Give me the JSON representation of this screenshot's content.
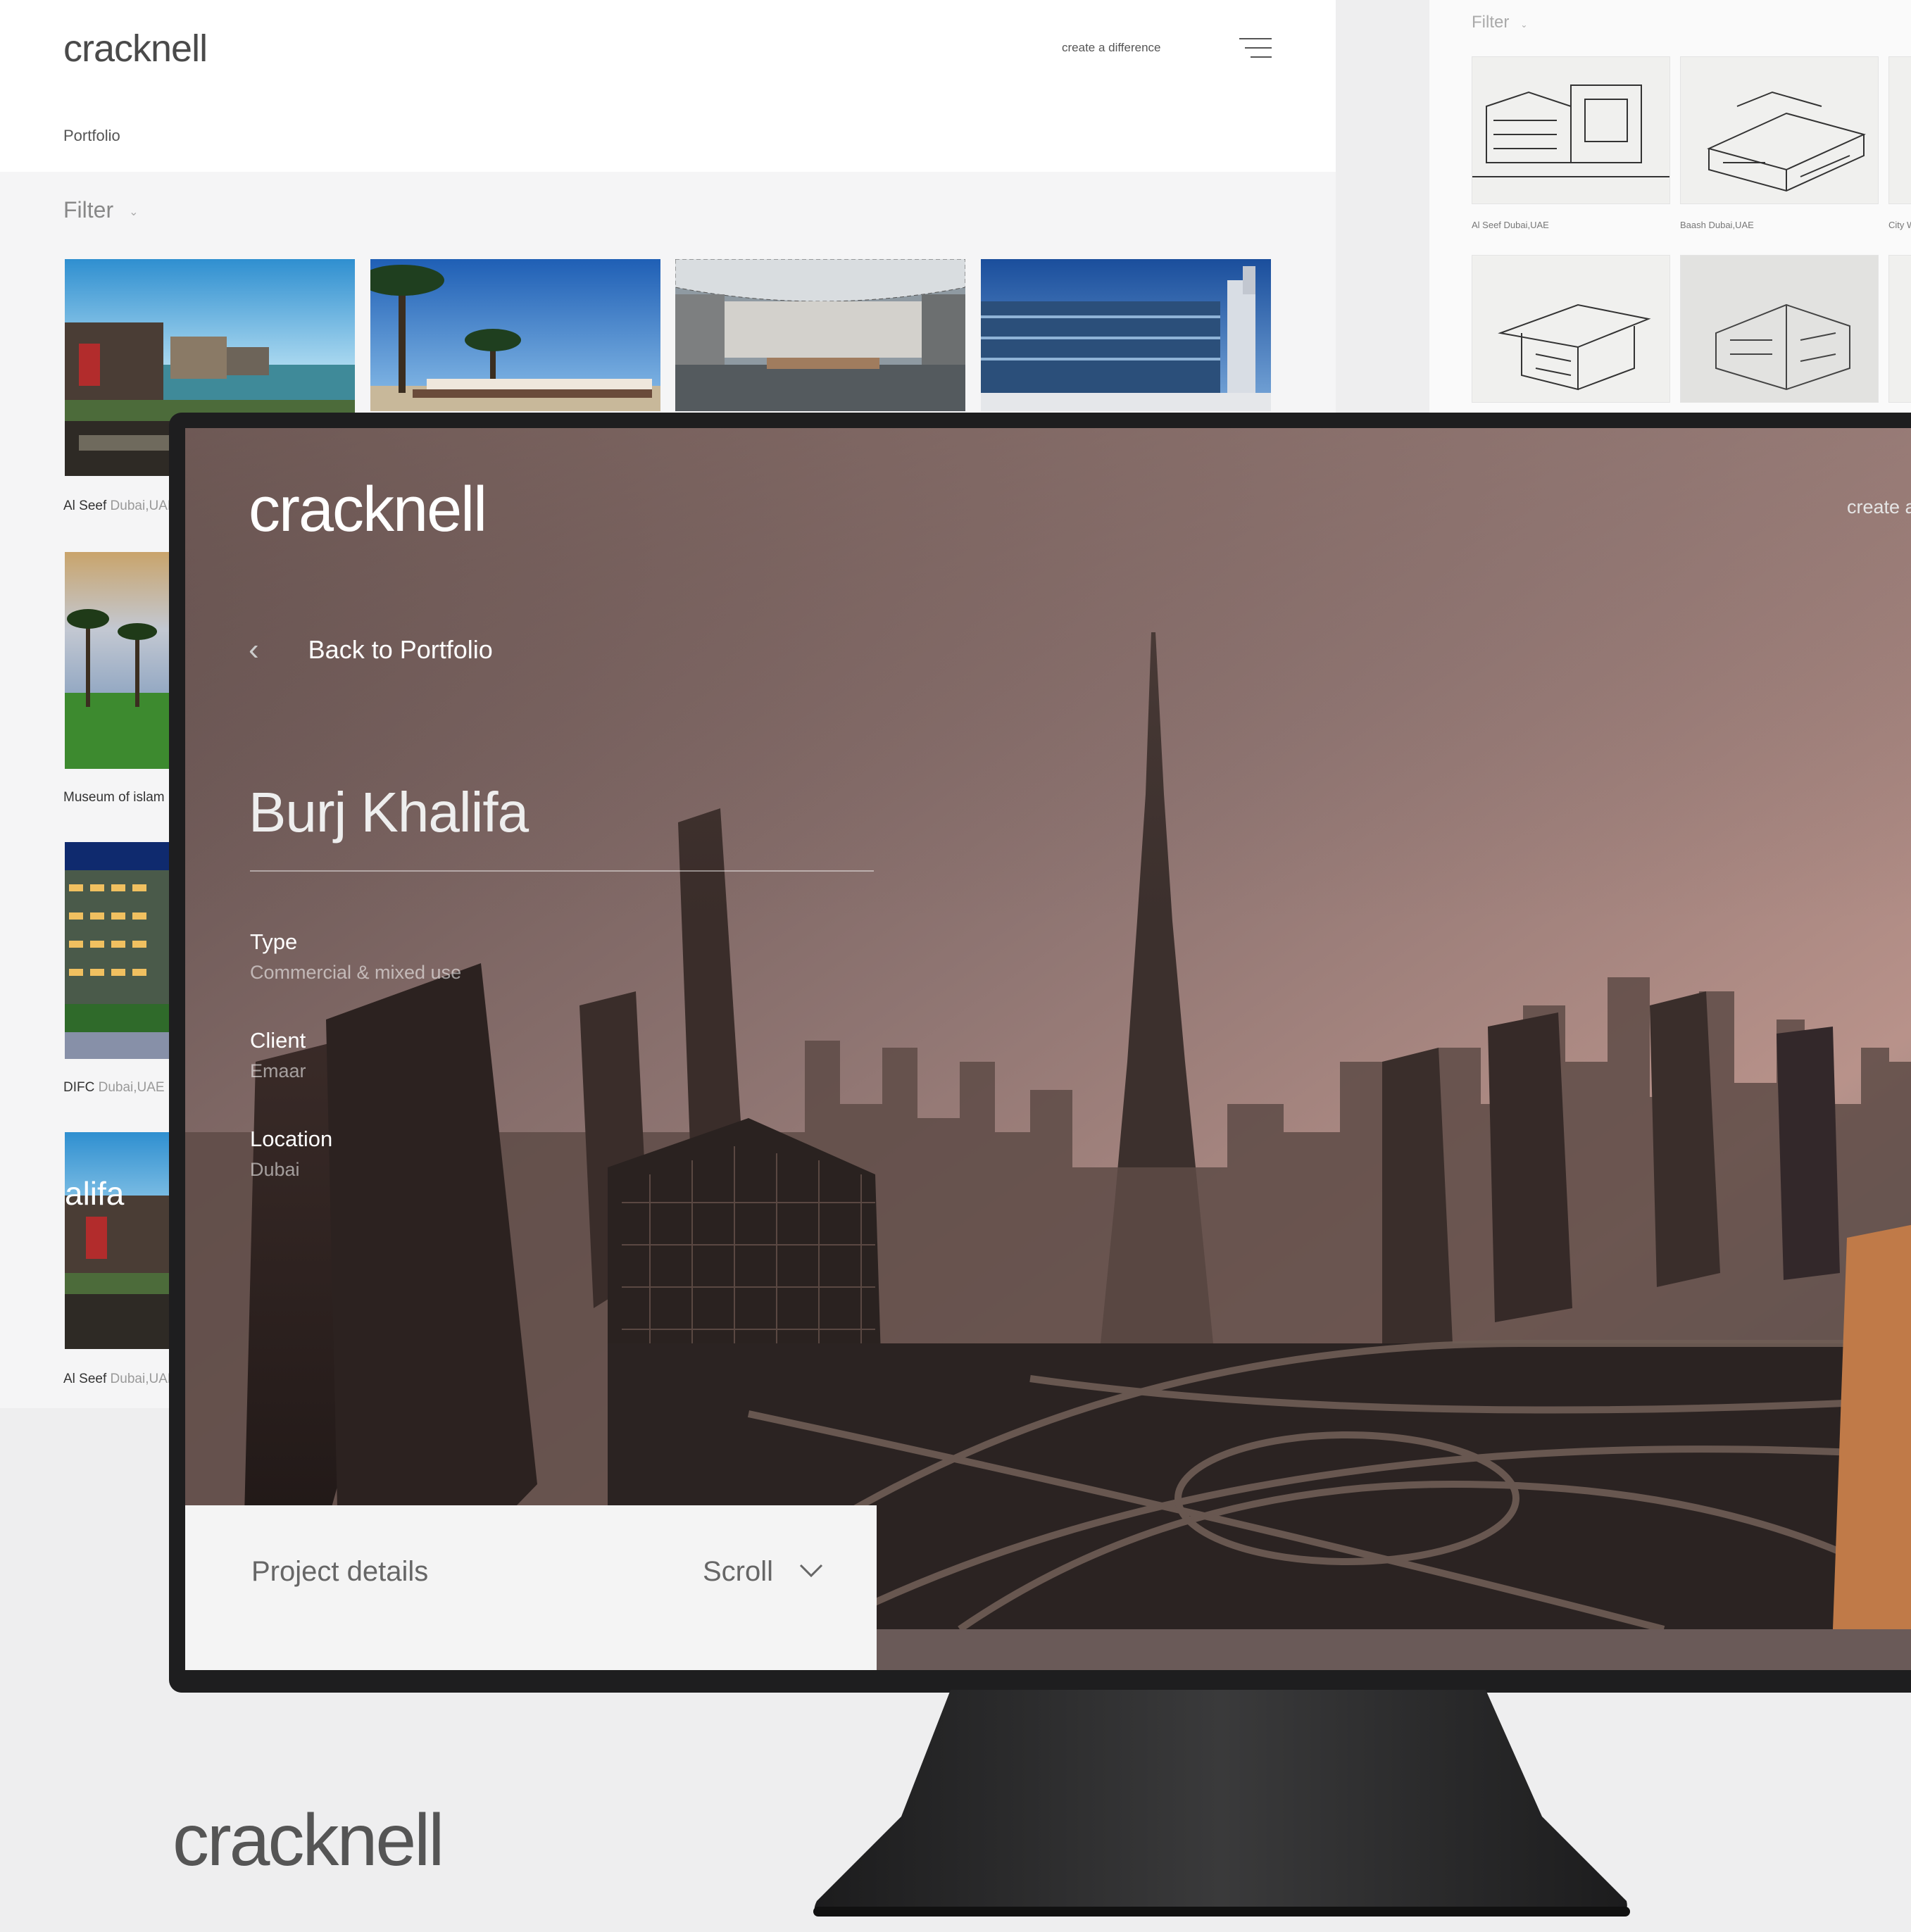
{
  "portfolio": {
    "logo": "cracknell",
    "tagline": "create a difference",
    "breadcrumb": "Portfolio",
    "filter_label": "Filter",
    "captions": [
      {
        "name": "Al Seef",
        "location": "Dubai,UAE"
      },
      {
        "name": "Museum of islam",
        "location": ""
      },
      {
        "name": "DIFC",
        "location": "Dubai,UAE"
      },
      {
        "name": "Al Seef",
        "location": "Dubai,UAE"
      }
    ],
    "overlay_fragment": "alifa"
  },
  "sketches": {
    "filter_label": "Filter",
    "captions": [
      "Al Seef Dubai,UAE",
      "Baash Dubai,UAE",
      "City W"
    ]
  },
  "project": {
    "logo": "cracknell",
    "tagline": "create a",
    "back_label": "Back to Portfolio",
    "title": "Burj Khalifa",
    "type_label": "Type",
    "type_value": "Commercial & mixed use",
    "client_label": "Client",
    "client_value": "Emaar",
    "location_label": "Location",
    "location_value": "Dubai",
    "details_label": "Project details",
    "scroll_label": "Scroll"
  },
  "brand": {
    "logo": "cracknell",
    "accent": "#4a4a4a"
  }
}
